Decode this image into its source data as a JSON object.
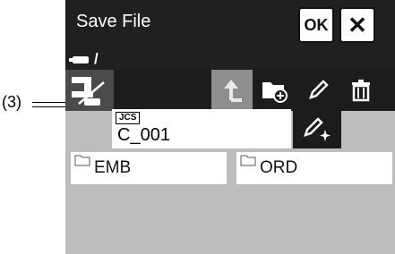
{
  "callout": {
    "label": "(3)"
  },
  "title": {
    "text": "Save File",
    "ok_label": "OK",
    "close_label": "✕"
  },
  "path": {
    "device_icon": "usb-device-icon",
    "text": "/"
  },
  "toolbar": {
    "usb_icon": "usb-storage-icon",
    "up_icon": "folder-up-icon",
    "new_folder_icon": "new-folder-icon",
    "edit_icon": "pencil-icon",
    "delete_icon": "trash-icon"
  },
  "filename": {
    "badge": "JCS",
    "value": "C_001",
    "rename_icon": "pencil-sparkle-icon"
  },
  "folders": [
    {
      "name": "EMB"
    },
    {
      "name": "ORD"
    }
  ],
  "colors": {
    "header": "#202020",
    "screen_bg": "#bdbdbd",
    "active_button": "#4a4a4a",
    "disabled_button": "#8e8e8e"
  }
}
